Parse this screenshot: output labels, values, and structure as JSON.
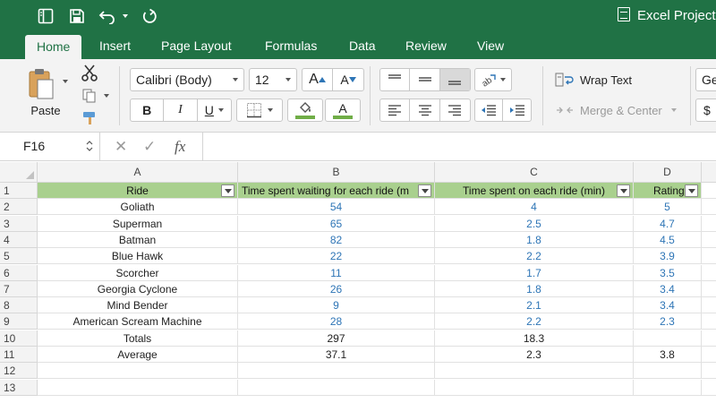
{
  "window": {
    "title": "Excel Project"
  },
  "quick_access": {
    "icons": [
      "sidebar-toggle-icon",
      "save-icon",
      "undo-icon",
      "dropdown-chevron-icon",
      "redo-icon"
    ]
  },
  "menu": {
    "tabs": [
      {
        "label": "Home",
        "active": true
      },
      {
        "label": "Insert"
      },
      {
        "label": "Page Layout"
      },
      {
        "label": "Formulas"
      },
      {
        "label": "Data"
      },
      {
        "label": "Review"
      },
      {
        "label": "View"
      }
    ]
  },
  "ribbon": {
    "paste_label": "Paste",
    "font_name": "Calibri (Body)",
    "font_size": "12",
    "increase_font_label": "A",
    "decrease_font_label": "A",
    "bold_label": "B",
    "italic_label": "I",
    "underline_label": "U",
    "font_color_letter": "A",
    "wrap_text_label": "Wrap Text",
    "merge_center_label": "Merge & Center",
    "number_format_partial": "Ge",
    "currency_partial": "$",
    "colors": {
      "fill": "#70ad47",
      "font_color": "#70ad47",
      "accent": "#207245"
    }
  },
  "formula_bar": {
    "cell_ref": "F16",
    "cancel_glyph": "✕",
    "enter_glyph": "✓",
    "fx_label": "fx",
    "formula": ""
  },
  "sheet": {
    "columns": [
      "A",
      "B",
      "C",
      "D"
    ],
    "row_numbers": [
      "1",
      "2",
      "3",
      "4",
      "5",
      "6",
      "7",
      "8",
      "9",
      "10",
      "11",
      "12",
      "13"
    ],
    "headers": [
      "Ride",
      "Time spent waiting for each ride (m",
      "Time spent on each ride (min)",
      "Rating"
    ],
    "rows": [
      [
        "Goliath",
        "54",
        "4",
        "5"
      ],
      [
        "Superman",
        "65",
        "2.5",
        "4.7"
      ],
      [
        "Batman",
        "82",
        "1.8",
        "4.5"
      ],
      [
        "Blue Hawk",
        "22",
        "2.2",
        "3.9"
      ],
      [
        "Scorcher",
        "11",
        "1.7",
        "3.5"
      ],
      [
        "Georgia Cyclone",
        "26",
        "1.8",
        "3.4"
      ],
      [
        "Mind Bender",
        "9",
        "2.1",
        "3.4"
      ],
      [
        "American Scream Machine",
        "28",
        "2.2",
        "2.3"
      ]
    ],
    "totals": [
      "Totals",
      "297",
      "18.3",
      ""
    ],
    "average": [
      "Average",
      "37.1",
      "2.3",
      "3.8"
    ],
    "header_fill": "#a9d08e",
    "number_color": "#2e75b6"
  }
}
